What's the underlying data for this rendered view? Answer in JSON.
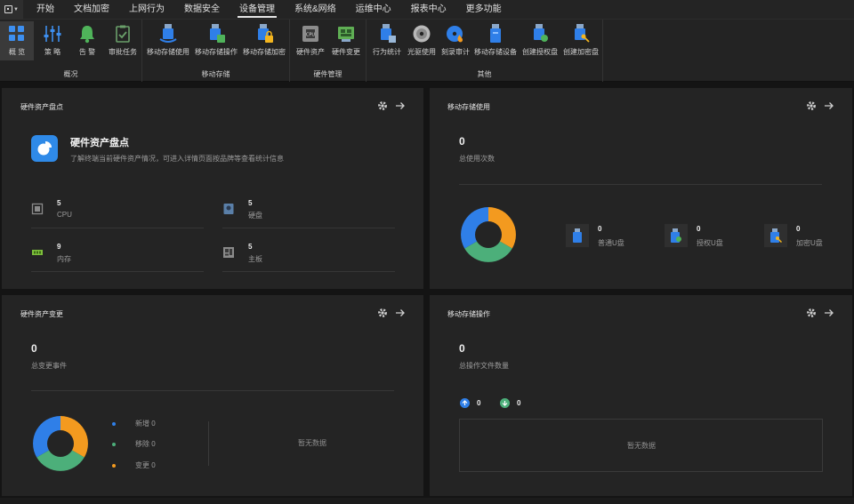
{
  "menu": {
    "tabs": [
      "开始",
      "文档加密",
      "上网行为",
      "数据安全",
      "设备管理",
      "系统&网络",
      "运维中心",
      "报表中心",
      "更多功能"
    ]
  },
  "ribbon": {
    "groups": [
      {
        "title": "概况",
        "buttons": [
          "概 览",
          "策 略",
          "告 警",
          "审批任务"
        ]
      },
      {
        "title": "移动存储",
        "buttons": [
          "移动存储使用",
          "移动存储操作",
          "移动存储加密"
        ]
      },
      {
        "title": "硬件管理",
        "buttons": [
          "硬件资产",
          "硬件变更"
        ]
      },
      {
        "title": "其他",
        "buttons": [
          "行为统计",
          "光驱使用",
          "刻录审计",
          "移动存储设备",
          "创建授权盘",
          "创建加密盘"
        ]
      }
    ]
  },
  "cards": {
    "hw_inventory": {
      "title": "硬件资产盘点",
      "banner_title": "硬件资产盘点",
      "banner_desc": "了解终端当前硬件资产情况，可进入详情页面按品牌等查看统计信息",
      "items": [
        {
          "value": "5",
          "label": "CPU",
          "icon": "cpu-icon"
        },
        {
          "value": "5",
          "label": "硬盘",
          "icon": "harddisk-icon"
        },
        {
          "value": "9",
          "label": "内存",
          "icon": "memory-icon"
        },
        {
          "value": "5",
          "label": "主板",
          "icon": "motherboard-icon"
        }
      ]
    },
    "usb_usage": {
      "title": "移动存储使用",
      "total": "0",
      "total_label": "总使用次数",
      "types": [
        {
          "value": "0",
          "label": "普通U盘"
        },
        {
          "value": "0",
          "label": "授权U盘"
        },
        {
          "value": "0",
          "label": "加密U盘"
        }
      ]
    },
    "hw_change": {
      "title": "硬件资产变更",
      "total": "0",
      "total_label": "总变更事件",
      "legend": [
        "新增 0",
        "移除 0",
        "变更 0"
      ],
      "empty": "暂无数据"
    },
    "usb_ops": {
      "title": "移动存储操作",
      "total": "0",
      "total_label": "总操作文件数量",
      "up": "0",
      "down": "0",
      "empty": "暂无数据"
    }
  },
  "colors": {
    "blue": "#2f7fe8",
    "orange": "#f39a1f",
    "green": "#4caf7a",
    "bg": "#141414",
    "card": "#242424"
  }
}
